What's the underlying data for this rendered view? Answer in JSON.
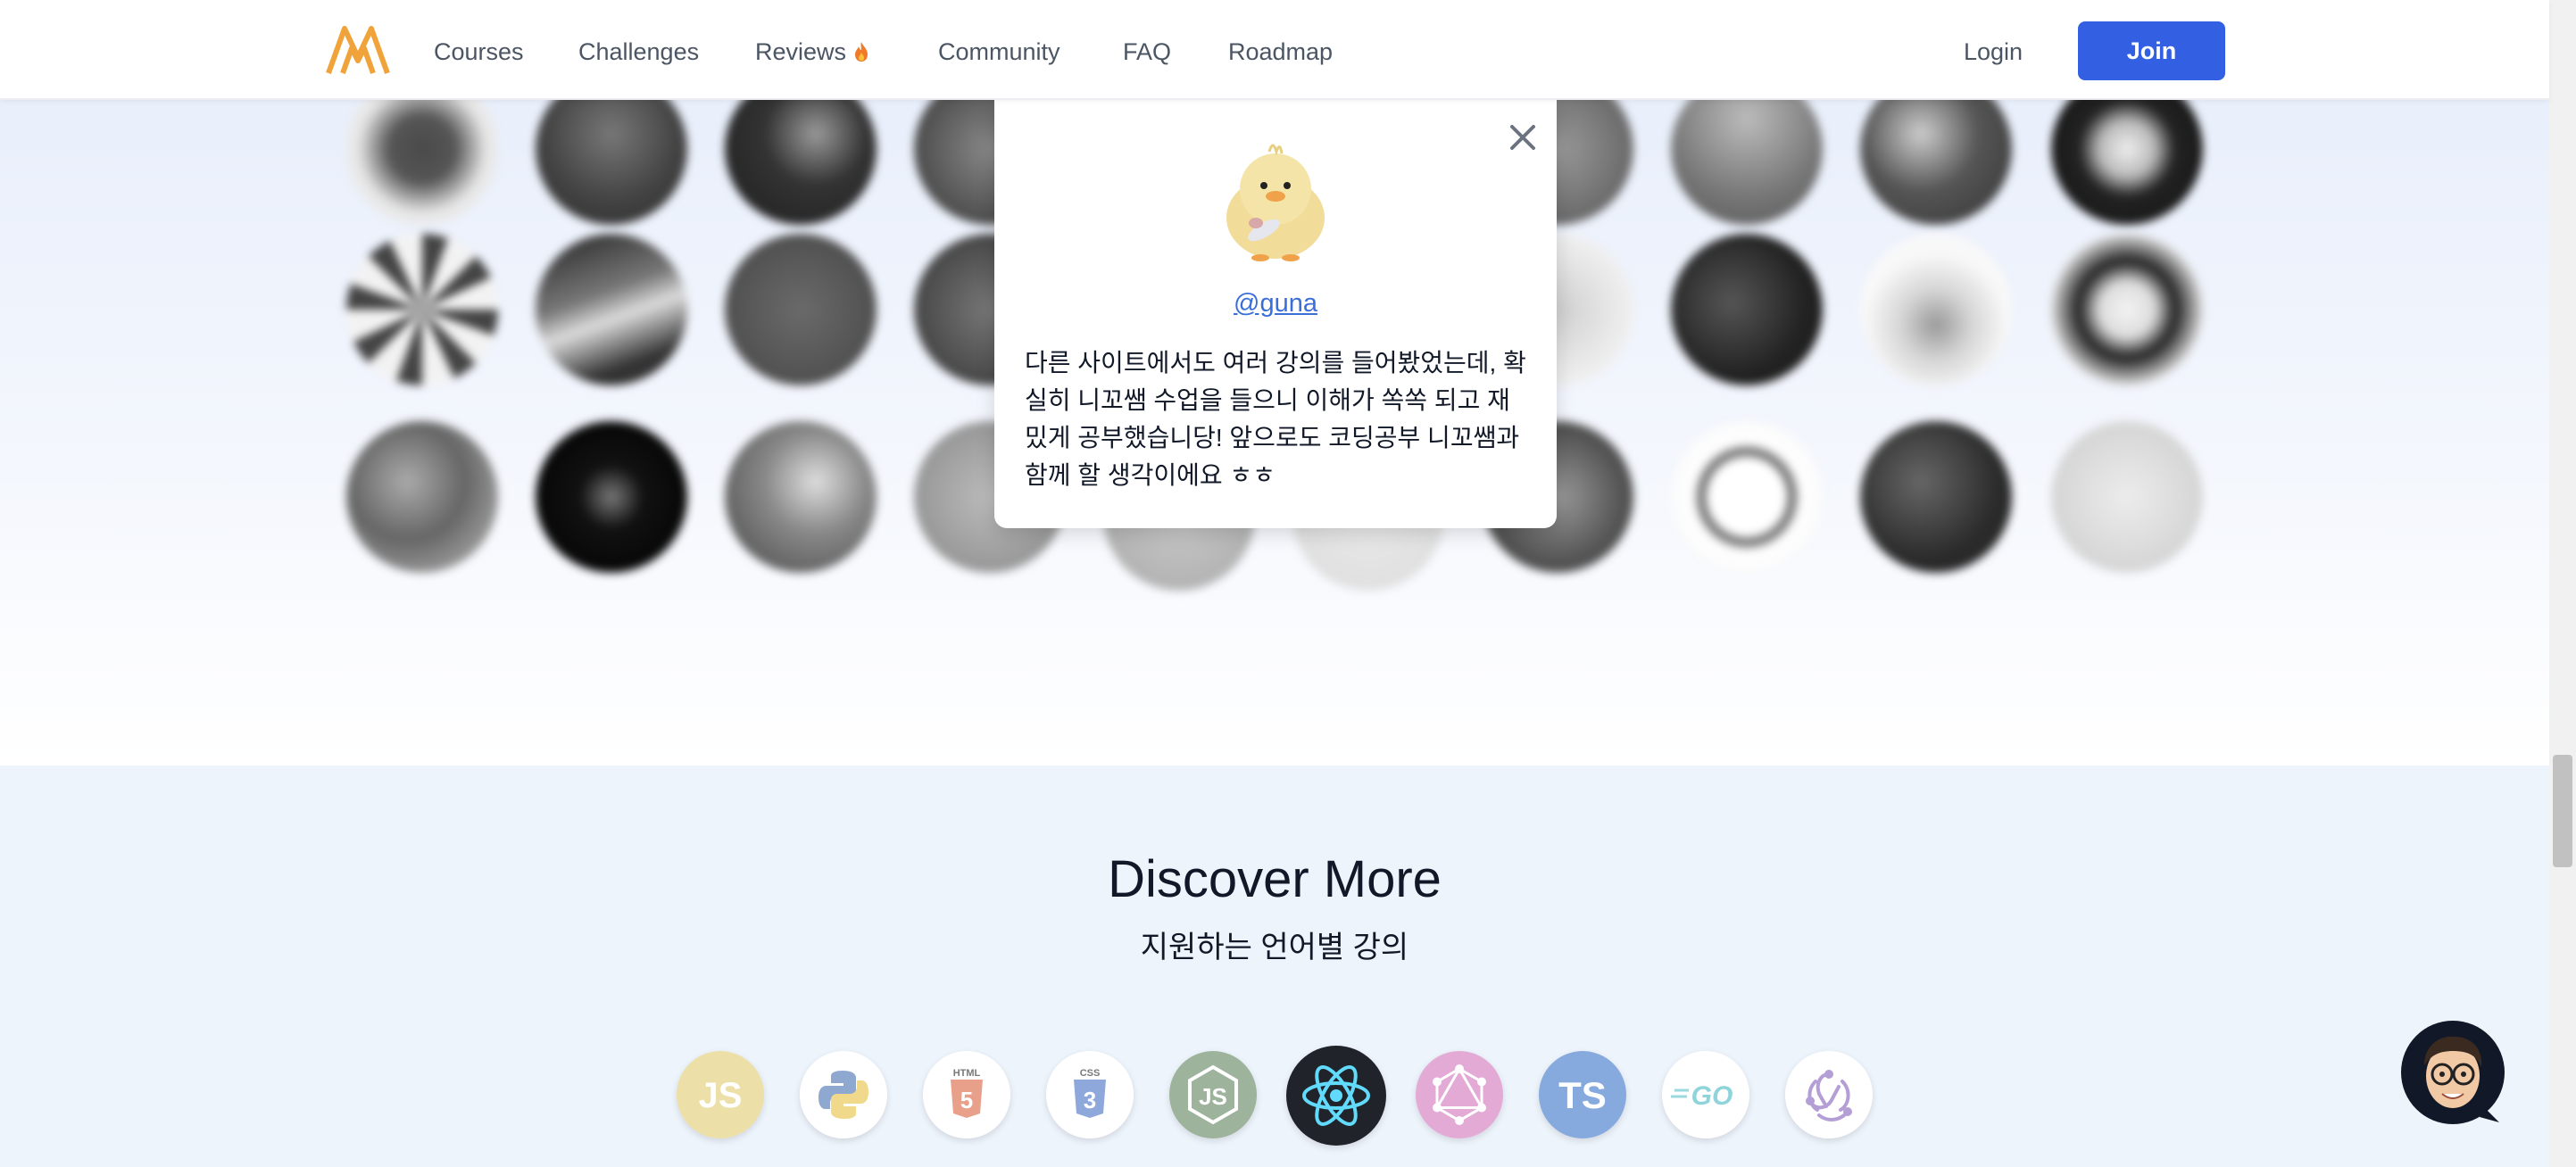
{
  "nav": {
    "links": [
      {
        "label": "Courses"
      },
      {
        "label": "Challenges"
      },
      {
        "label": "Reviews"
      },
      {
        "label": "Community"
      },
      {
        "label": "FAQ"
      },
      {
        "label": "Roadmap"
      }
    ],
    "login_label": "Login",
    "join_label": "Join"
  },
  "review": {
    "handle": "@guna",
    "text": "다른 사이트에서도 여러 강의를 들어봤었는데, 확실히 니꼬쌤 수업을 들으니 이해가 쏙쏙 되고 재밌게 공부했습니당! 앞으로도 코딩공부 니꼬쌤과 함께 할 생각이에요 ㅎㅎ"
  },
  "discover": {
    "title": "Discover More",
    "subtitle": "지원하는 언어별 강의",
    "languages": [
      {
        "icon": "javascript-icon",
        "text": "JS",
        "color": "#f0d95c"
      },
      {
        "icon": "python-icon",
        "text": "",
        "color": "#ffffff"
      },
      {
        "icon": "html5-icon",
        "text": "HTML",
        "color": "#ffffff"
      },
      {
        "icon": "css3-icon",
        "text": "CSS",
        "color": "#ffffff"
      },
      {
        "icon": "nodejs-icon",
        "text": "JS",
        "color": "#8fae8e"
      },
      {
        "icon": "react-icon",
        "text": "",
        "color": "#20232a"
      },
      {
        "icon": "graphql-icon",
        "text": "",
        "color": "#e6a8d6"
      },
      {
        "icon": "typescript-icon",
        "text": "TS",
        "color": "#7fa6e0"
      },
      {
        "icon": "go-icon",
        "text": "GO",
        "color": "#ffffff"
      },
      {
        "icon": "redux-icon",
        "text": "",
        "color": "#ffffff"
      }
    ]
  },
  "colors": {
    "primary": "#3360e3",
    "logo": "#f0a33a",
    "link": "#3b6fd8"
  }
}
